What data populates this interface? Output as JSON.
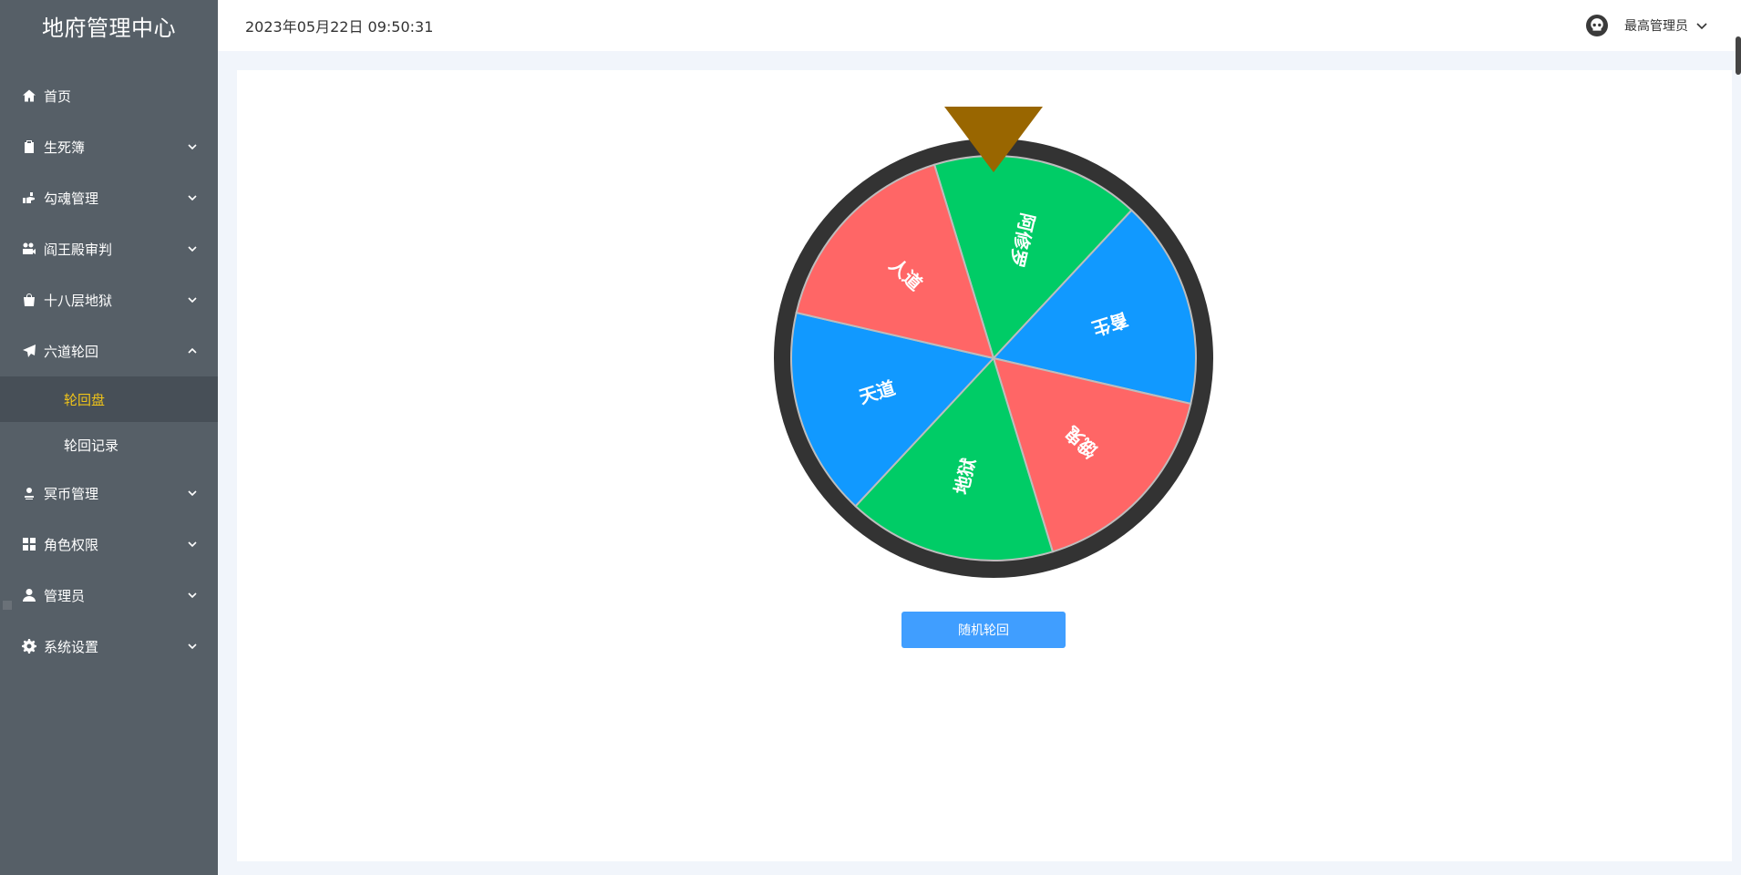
{
  "app": {
    "title": "地府管理中心"
  },
  "header": {
    "datetime": "2023年05月22日 09:50:31",
    "user_name": "最高管理员",
    "avatar_icon": "skull-icon"
  },
  "sidebar": {
    "items": [
      {
        "label": "首页",
        "icon": "home-icon",
        "expandable": false
      },
      {
        "label": "生死簿",
        "icon": "clipboard-icon",
        "expandable": true
      },
      {
        "label": "勾魂管理",
        "icon": "hand-icon",
        "expandable": true
      },
      {
        "label": "阎王殿审判",
        "icon": "camera-icon",
        "expandable": true
      },
      {
        "label": "十八层地狱",
        "icon": "bag-icon",
        "expandable": true
      },
      {
        "label": "六道轮回",
        "icon": "paper-plane-icon",
        "expandable": true,
        "expanded": true,
        "children": [
          {
            "label": "轮回盘",
            "active": true
          },
          {
            "label": "轮回记录",
            "active": false
          }
        ]
      },
      {
        "label": "冥币管理",
        "icon": "user-stamp-icon",
        "expandable": true
      },
      {
        "label": "角色权限",
        "icon": "grid-icon",
        "expandable": true
      },
      {
        "label": "管理员",
        "icon": "person-icon",
        "expandable": true
      },
      {
        "label": "系统设置",
        "icon": "gear-icon",
        "expandable": true
      }
    ]
  },
  "wheel": {
    "pointer_color": "#996600",
    "rim_color": "#333333",
    "segments": [
      {
        "label": "阿修罗",
        "color": "#00cc66"
      },
      {
        "label": "畜生",
        "color": "#1199ff"
      },
      {
        "label": "饿鬼",
        "color": "#ff6666"
      },
      {
        "label": "地狱",
        "color": "#00cc66"
      },
      {
        "label": "天道",
        "color": "#1199ff"
      },
      {
        "label": "人道",
        "color": "#ff6666"
      }
    ]
  },
  "actions": {
    "spin_label": "随机轮回"
  }
}
